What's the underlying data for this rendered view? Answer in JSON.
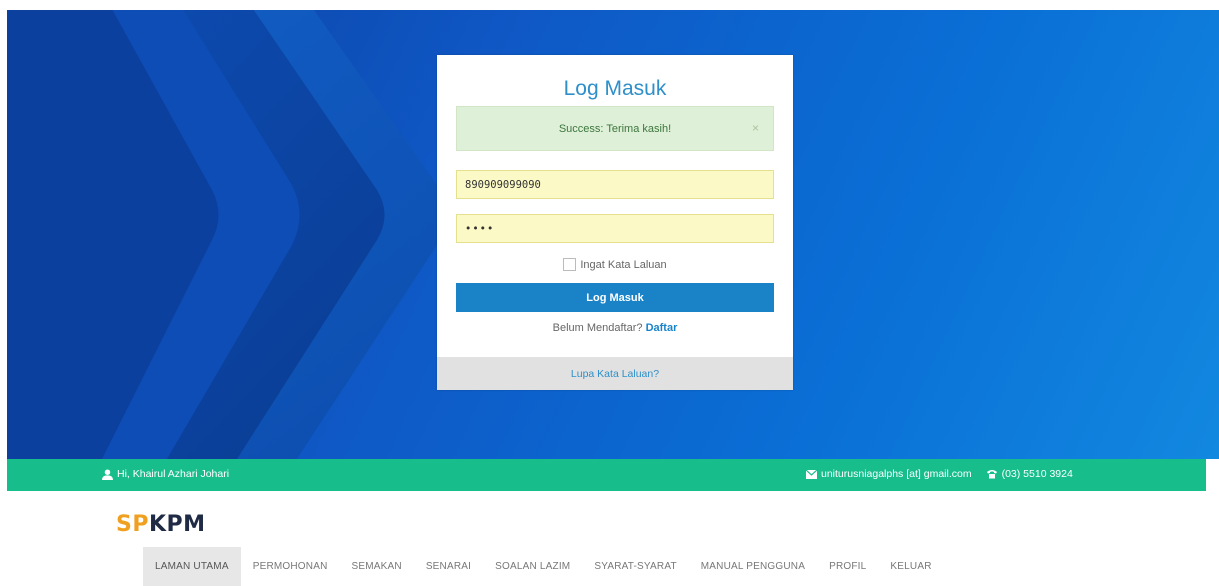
{
  "login": {
    "title": "Log Masuk",
    "alert_text": "Success: Terima kasih!",
    "alert_close": "×",
    "ic_value": "890909099090",
    "password_value": "••••",
    "remember_label": "Ingat Kata Laluan",
    "submit_label": "Log Masuk",
    "register_prompt": "Belum Mendaftar?",
    "register_link": "Daftar",
    "forgot_label": "Lupa Kata Laluan?"
  },
  "topbar": {
    "user_icon": "user-icon",
    "greeting": "Hi, Khairul Azhari Johari",
    "email_icon": "envelope-icon",
    "email": "uniturusniagalphs [at] gmail.com",
    "phone_icon": "phone-icon",
    "phone": "(03) 5510 3924",
    "bar_color": "#17be8c"
  },
  "logo": {
    "part1": "SP",
    "part2": "KPM"
  },
  "nav": {
    "items": [
      {
        "label": "LAMAN UTAMA"
      },
      {
        "label": "PERMOHONAN"
      },
      {
        "label": "SEMAKAN"
      },
      {
        "label": "SENARAI"
      },
      {
        "label": "SOALAN LAZIM"
      },
      {
        "label": "SYARAT-SYARAT"
      },
      {
        "label": "MANUAL PENGGUNA"
      },
      {
        "label": "PROFIL"
      },
      {
        "label": "KELUAR"
      }
    ]
  },
  "colors": {
    "accent": "#1a83c8",
    "success_bg": "#dff0d8",
    "autofill_bg": "#fbf9c6"
  }
}
